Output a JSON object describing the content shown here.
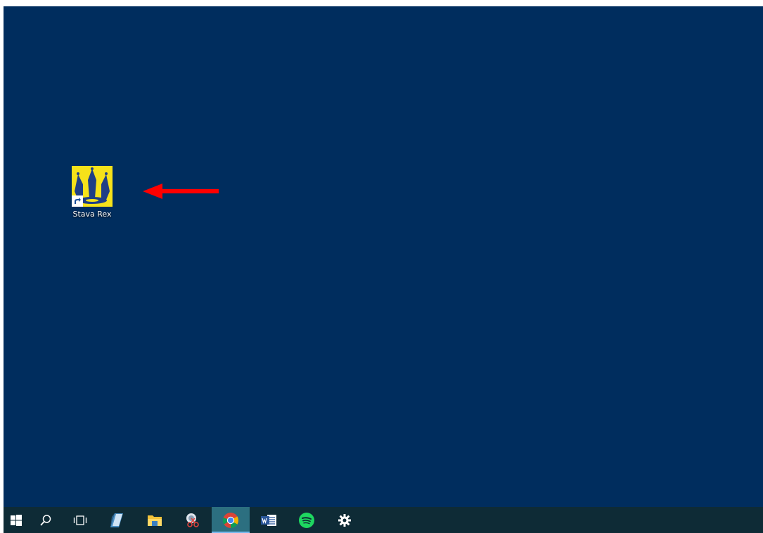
{
  "desktop": {
    "background": "#002d5e",
    "icons": [
      {
        "label": "Stava Rex",
        "icon": "stava-rex-icon",
        "shortcut": true
      }
    ],
    "annotation_arrow": {
      "color": "#ff0000",
      "direction": "left"
    }
  },
  "taskbar": {
    "background": "#0e2b36",
    "active_color": "#2c6f80",
    "items": [
      {
        "icon": "windows-start-icon"
      },
      {
        "icon": "search-icon"
      },
      {
        "icon": "task-view-icon"
      },
      {
        "icon": "notes-app-icon"
      },
      {
        "icon": "file-explorer-icon"
      },
      {
        "icon": "snipping-tool-icon"
      },
      {
        "icon": "chrome-icon",
        "active": true
      },
      {
        "icon": "word-icon"
      },
      {
        "icon": "spotify-icon"
      },
      {
        "icon": "settings-gear-icon"
      }
    ]
  }
}
